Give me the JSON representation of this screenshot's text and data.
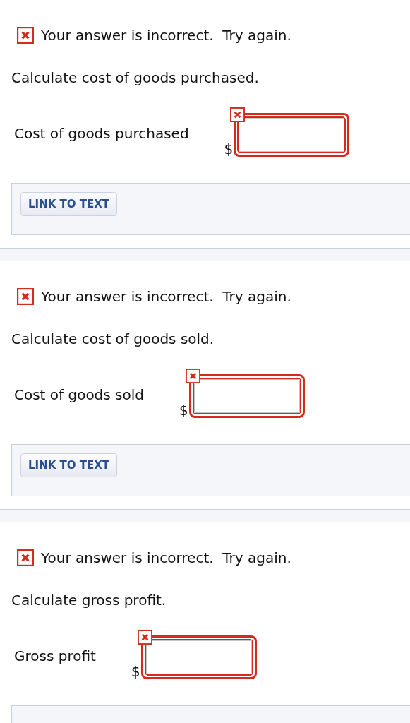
{
  "questions": [
    {
      "incorrect": true,
      "feedback": "Your answer is incorrect.  Try again.",
      "instruction": "Calculate cost of goods purchased.",
      "field": {
        "label": "Cost of goods purchased",
        "prefix": "$"
      },
      "link_button": "LINK TO TEXT"
    },
    {
      "incorrect": true,
      "feedback": "Your answer is incorrect.  Try again.",
      "instruction": "Calculate cost of goods sold.",
      "field": {
        "label": "Cost of goods sold",
        "prefix": "$"
      },
      "link_button": "LINK TO TEXT"
    },
    {
      "incorrect": true,
      "feedback": "Your answer is incorrect.  Try again.",
      "instruction": "Calculate gross profit.",
      "field": {
        "label": "Gross profit",
        "prefix": "$"
      }
    }
  ]
}
